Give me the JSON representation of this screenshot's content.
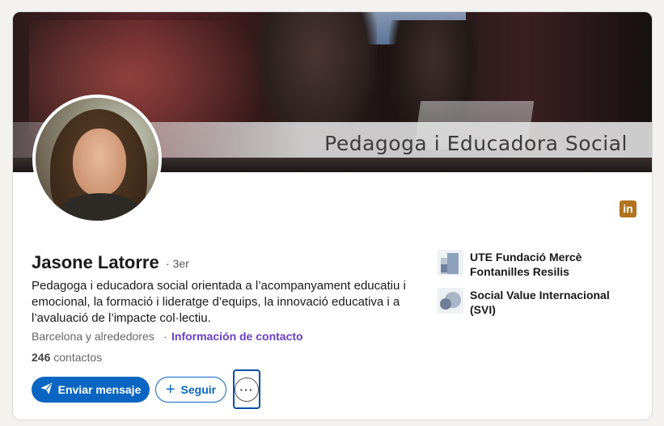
{
  "banner": {
    "text": "Pedagoga i Educadora Social"
  },
  "profile": {
    "name": "Jasone Latorre",
    "degree": "· 3er",
    "headline": "Pedagoga i educadora social orientada a l’acompanyament educatiu i emocional, la formació i lideratge d’equips, la innovació educativa i a l’avaluació de l’impacte col·lectiu.",
    "location": "Barcelona y alrededores",
    "separator": "·",
    "contact_info_label": "Información de contacto",
    "connections_count": "246",
    "connections_label": "contactos"
  },
  "actions": {
    "message_label": "Enviar mensaje",
    "follow_label": "Seguir",
    "more_label": "···"
  },
  "organizations": [
    {
      "name": "UTE Fundació Mercè Fontanilles Resilis"
    },
    {
      "name": "Social Value Internacional (SVI)"
    }
  ],
  "icons": {
    "linkedin_badge": "linkedin-icon",
    "linkedin_badge_text": "in",
    "send": "paper-plane-icon",
    "follow": "plus-icon"
  },
  "colors": {
    "primary": "#0a66c2",
    "contact_link": "#6a3fc4",
    "linkedin_badge": "#b0731f",
    "focus_ring": "#0a4fa8"
  }
}
